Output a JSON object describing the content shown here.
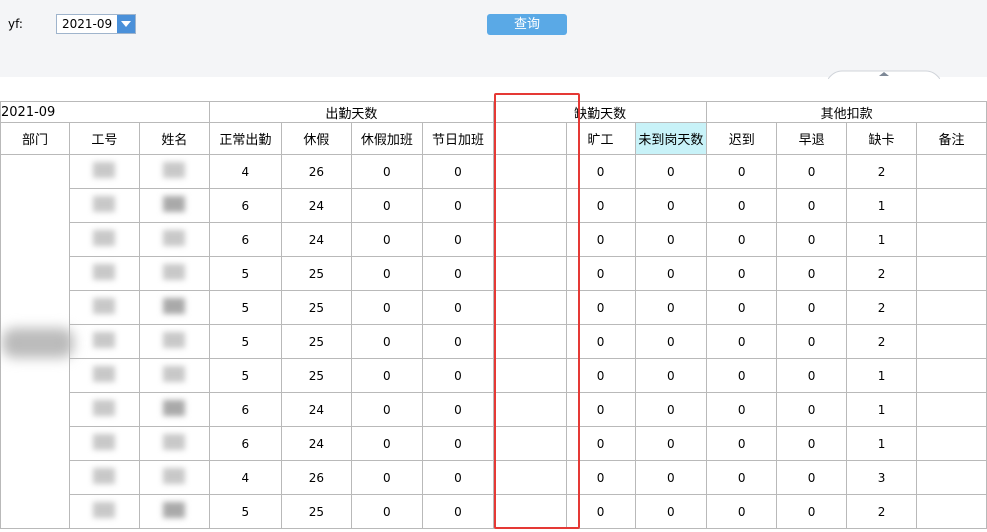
{
  "filter": {
    "label": "yf:",
    "value": "2021-09",
    "query_button": "查询"
  },
  "table": {
    "period": "2021-09",
    "groups": [
      "出勤天数",
      "缺勤天数",
      "其他扣款"
    ],
    "columns": [
      "部门",
      "工号",
      "姓名",
      "正常出勤",
      "休假",
      "休假加班",
      "节日加班",
      "",
      "旷工",
      "未到岗天数",
      "迟到",
      "早退",
      "缺卡",
      "备注"
    ],
    "rows": [
      {
        "normal": "4",
        "leave": "26",
        "leave_ot": "0",
        "holiday_ot": "0",
        "absent": "0",
        "not_arrived": "0",
        "late": "0",
        "early": "0",
        "missing": "2",
        "note": ""
      },
      {
        "normal": "6",
        "leave": "24",
        "leave_ot": "0",
        "holiday_ot": "0",
        "absent": "0",
        "not_arrived": "0",
        "late": "0",
        "early": "0",
        "missing": "1",
        "note": ""
      },
      {
        "normal": "6",
        "leave": "24",
        "leave_ot": "0",
        "holiday_ot": "0",
        "absent": "0",
        "not_arrived": "0",
        "late": "0",
        "early": "0",
        "missing": "1",
        "note": ""
      },
      {
        "normal": "5",
        "leave": "25",
        "leave_ot": "0",
        "holiday_ot": "0",
        "absent": "0",
        "not_arrived": "0",
        "late": "0",
        "early": "0",
        "missing": "2",
        "note": ""
      },
      {
        "normal": "5",
        "leave": "25",
        "leave_ot": "0",
        "holiday_ot": "0",
        "absent": "0",
        "not_arrived": "0",
        "late": "0",
        "early": "0",
        "missing": "2",
        "note": ""
      },
      {
        "normal": "5",
        "leave": "25",
        "leave_ot": "0",
        "holiday_ot": "0",
        "absent": "0",
        "not_arrived": "0",
        "late": "0",
        "early": "0",
        "missing": "2",
        "note": ""
      },
      {
        "normal": "5",
        "leave": "25",
        "leave_ot": "0",
        "holiday_ot": "0",
        "absent": "0",
        "not_arrived": "0",
        "late": "0",
        "early": "0",
        "missing": "1",
        "note": ""
      },
      {
        "normal": "6",
        "leave": "24",
        "leave_ot": "0",
        "holiday_ot": "0",
        "absent": "0",
        "not_arrived": "0",
        "late": "0",
        "early": "0",
        "missing": "1",
        "note": ""
      },
      {
        "normal": "6",
        "leave": "24",
        "leave_ot": "0",
        "holiday_ot": "0",
        "absent": "0",
        "not_arrived": "0",
        "late": "0",
        "early": "0",
        "missing": "1",
        "note": ""
      },
      {
        "normal": "4",
        "leave": "26",
        "leave_ot": "0",
        "holiday_ot": "0",
        "absent": "0",
        "not_arrived": "0",
        "late": "0",
        "early": "0",
        "missing": "3",
        "note": ""
      },
      {
        "normal": "5",
        "leave": "25",
        "leave_ot": "0",
        "holiday_ot": "0",
        "absent": "0",
        "not_arrived": "0",
        "late": "0",
        "early": "0",
        "missing": "2",
        "note": ""
      }
    ]
  },
  "colors": {
    "highlight": "#c8f2f8",
    "annotation": "#e53935",
    "button": "#5aa9e6"
  },
  "icons": {
    "dropdown": "chevron-down-icon",
    "collapse": "chevron-up-icon"
  }
}
